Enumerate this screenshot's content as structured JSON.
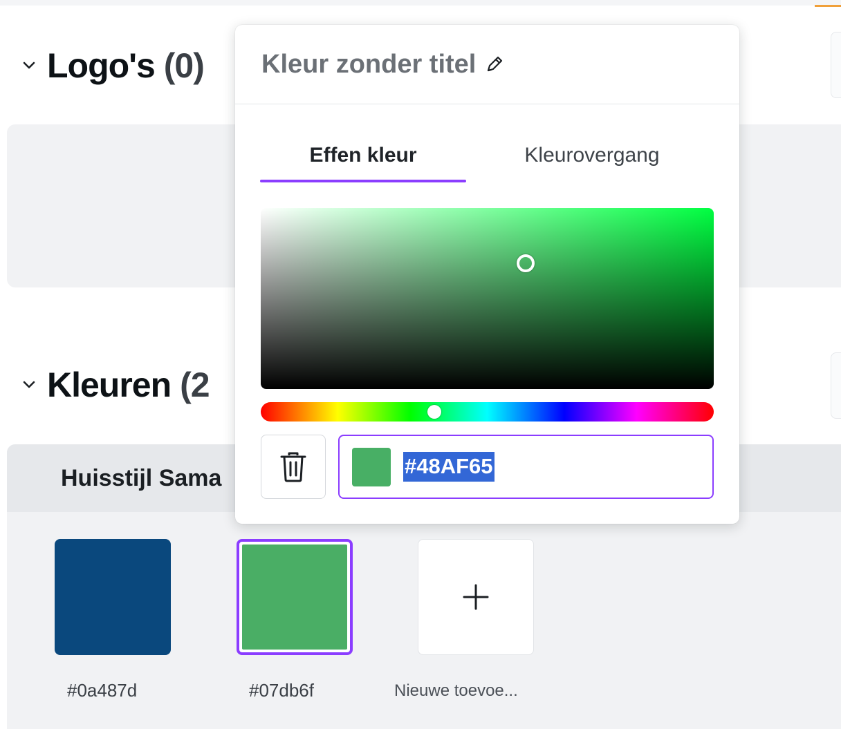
{
  "sections": {
    "logos": {
      "title": "Logo's",
      "count": "(0)"
    },
    "colors": {
      "title": "Kleuren",
      "count": "(2"
    }
  },
  "brand_kit": {
    "name": "Huisstijl Sama"
  },
  "swatches": [
    {
      "label": "#0a487d",
      "color": "#0a487d"
    },
    {
      "label": "#07db6f",
      "color": "#4aae65"
    }
  ],
  "add_swatch": {
    "label": "Nieuwe toevoe..."
  },
  "color_picker": {
    "title": "Kleur zonder titel",
    "tabs": [
      {
        "label": "Effen kleur",
        "active": true
      },
      {
        "label": "Kleurovergang",
        "active": false
      }
    ],
    "hex_value": "#48AF65",
    "preview_color": "#48af65",
    "hue_position": 0.38
  },
  "accent_color": "#8b3dff"
}
